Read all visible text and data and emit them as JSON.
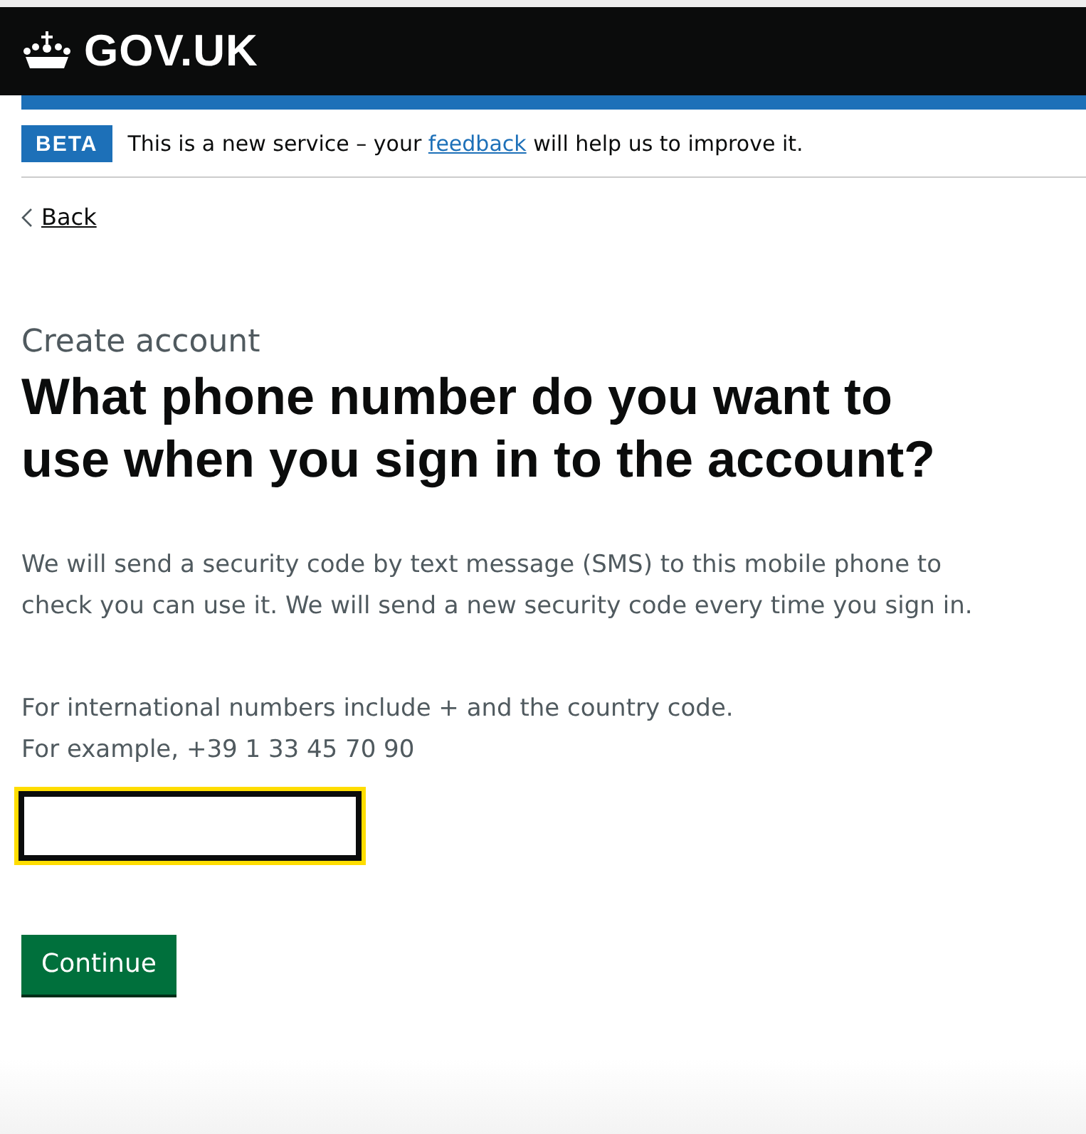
{
  "header": {
    "logo_text": "GOV.UK"
  },
  "phase_banner": {
    "tag": "BETA",
    "text_before": "This is a new service – your",
    "link": "feedback",
    "text_after": "will help us to improve it."
  },
  "back_link": {
    "label": "Back"
  },
  "caption": "Create account",
  "heading": "What phone number do you want to use when you sign in to the account?",
  "body": "We will send a security code by text message (SMS) to this mobile phone to check you can use it. We will send a new security code every time you sign in.",
  "hint": [
    "For international numbers include + and the country code.",
    "For example, +39 1 33 45 70 90"
  ],
  "phone_input": {
    "focused": true
  },
  "button": {
    "label": "Continue"
  }
}
